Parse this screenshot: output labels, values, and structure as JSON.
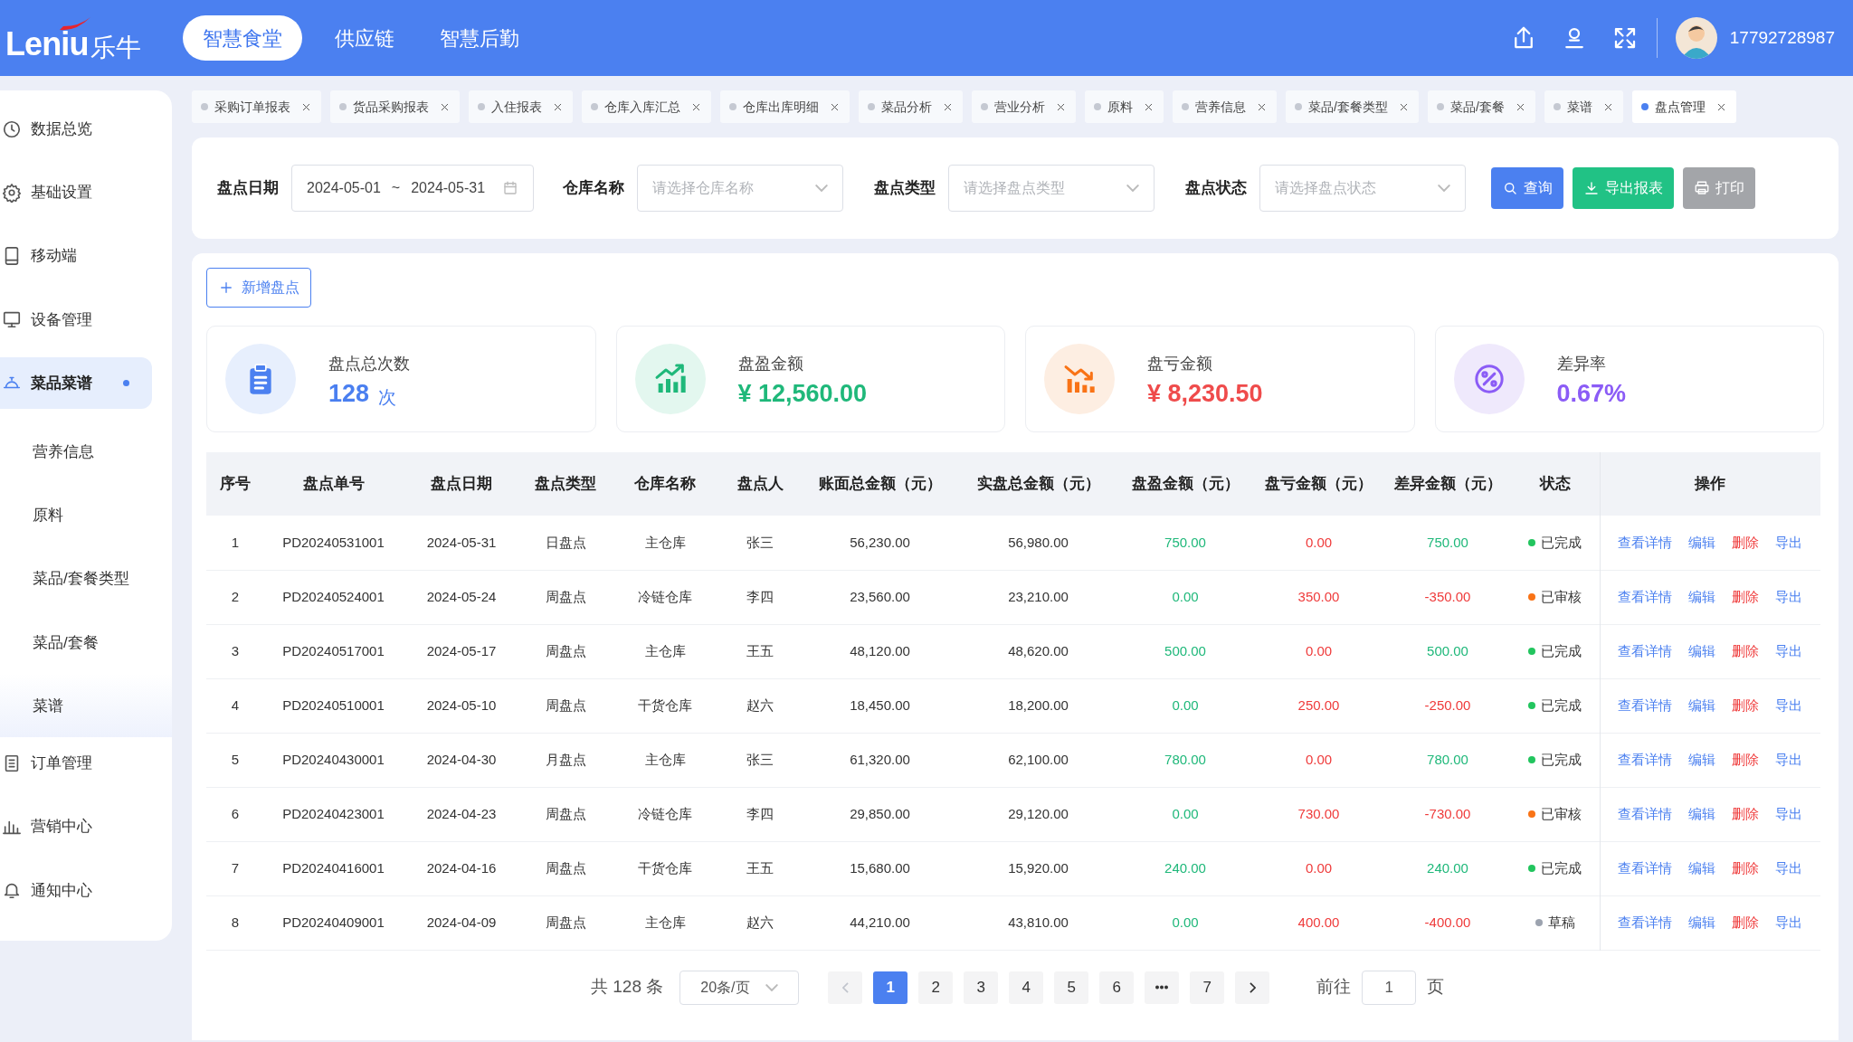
{
  "header": {
    "logo": {
      "latin": "Leniu",
      "chinese": "乐牛"
    },
    "nav": [
      {
        "label": "智慧食堂",
        "selected": true
      },
      {
        "label": "供应链",
        "selected": false
      },
      {
        "label": "智慧后勤",
        "selected": false
      }
    ],
    "user": {
      "phone": "17792728987"
    }
  },
  "tabs": [
    {
      "label": "采购订单报表",
      "selected": false
    },
    {
      "label": "货品采购报表",
      "selected": false
    },
    {
      "label": "入住报表",
      "selected": false
    },
    {
      "label": "仓库入库汇总",
      "selected": false
    },
    {
      "label": "仓库出库明细",
      "selected": false
    },
    {
      "label": "菜品分析",
      "selected": false
    },
    {
      "label": "营业分析",
      "selected": false
    },
    {
      "label": "原料",
      "selected": false
    },
    {
      "label": "营养信息",
      "selected": false
    },
    {
      "label": "菜品/套餐类型",
      "selected": false
    },
    {
      "label": "菜品/套餐",
      "selected": false
    },
    {
      "label": "菜谱",
      "selected": false
    },
    {
      "label": "盘点管理",
      "selected": true
    }
  ],
  "sidebar": {
    "items": [
      {
        "label": "数据总览",
        "selected": false
      },
      {
        "label": "基础设置",
        "selected": false
      },
      {
        "label": "移动端",
        "selected": false
      },
      {
        "label": "设备管理",
        "selected": false
      },
      {
        "label": "菜品菜谱",
        "selected": true,
        "children": [
          {
            "label": "营养信息",
            "selected": false
          },
          {
            "label": "原料",
            "selected": false
          },
          {
            "label": "菜品/套餐类型",
            "selected": false
          },
          {
            "label": "菜品/套餐",
            "selected": false
          },
          {
            "label": "菜谱",
            "selected": true
          }
        ]
      },
      {
        "label": "订单管理",
        "selected": false
      },
      {
        "label": "营销中心",
        "selected": false
      },
      {
        "label": "通知中心",
        "selected": false
      }
    ]
  },
  "filters": [
    {
      "kind": "daterange",
      "label": "盘点日期",
      "start": "2024-05-01",
      "separator": "~",
      "end": "2024-05-31"
    },
    {
      "kind": "select",
      "label": "仓库名称",
      "placeholder": "请选择仓库名称"
    },
    {
      "kind": "select",
      "label": "盘点类型",
      "placeholder": "请选择盘点类型"
    },
    {
      "kind": "select",
      "label": "盘点状态",
      "placeholder": "请选择盘点状态"
    }
  ],
  "filter_buttons": [
    {
      "label": "查询",
      "kind": "search"
    },
    {
      "label": "导出报表",
      "kind": "export"
    },
    {
      "label": "打印",
      "kind": "print"
    }
  ],
  "add_button": {
    "label": "新增盘点"
  },
  "stats": [
    {
      "kind": "clipboard",
      "label": "盘点总次数",
      "value": "128",
      "unit": "次",
      "color": "#4a7ff0"
    },
    {
      "kind": "gain",
      "label": "盘盈金额",
      "value": "¥ 12,560.00",
      "color": "#1fb87a"
    },
    {
      "kind": "loss",
      "label": "盘亏金额",
      "value": "¥ 8,230.50",
      "color": "#ef4b4b"
    },
    {
      "kind": "percent",
      "label": "差异率",
      "value": "0.67%",
      "color": "#8b5cf6"
    }
  ],
  "table": {
    "columns": [
      "序号",
      "盘点单号",
      "盘点日期",
      "盘点类型",
      "仓库名称",
      "盘点人",
      "账面总金额（元）",
      "实盘总金额（元）",
      "盘盈金额（元）",
      "盘亏金额（元）",
      "差异金额（元）",
      "状态",
      "操作"
    ],
    "rows": [
      {
        "kind": "gain",
        "cells": [
          "1",
          "PD20240531001",
          "2024-05-31",
          "日盘点",
          "主仓库",
          "张三",
          "56,230.00",
          "56,980.00",
          "750.00",
          "0.00",
          "750.00"
        ],
        "status": {
          "label": "已完成",
          "color": "#22c55e"
        },
        "actions": [
          "查看详情",
          "编辑",
          "删除",
          "导出"
        ]
      },
      {
        "kind": "loss",
        "cells": [
          "2",
          "PD20240524001",
          "2024-05-24",
          "周盘点",
          "冷链仓库",
          "李四",
          "23,560.00",
          "23,210.00",
          "0.00",
          "350.00",
          "-350.00"
        ],
        "status": {
          "label": "已审核",
          "color": "#f97316"
        },
        "actions": [
          "查看详情",
          "编辑",
          "删除",
          "导出"
        ]
      },
      {
        "kind": "gain",
        "cells": [
          "3",
          "PD20240517001",
          "2024-05-17",
          "周盘点",
          "主仓库",
          "王五",
          "48,120.00",
          "48,620.00",
          "500.00",
          "0.00",
          "500.00"
        ],
        "status": {
          "label": "已完成",
          "color": "#22c55e"
        },
        "actions": [
          "查看详情",
          "编辑",
          "删除",
          "导出"
        ]
      },
      {
        "kind": "loss",
        "cells": [
          "4",
          "PD20240510001",
          "2024-05-10",
          "周盘点",
          "干货仓库",
          "赵六",
          "18,450.00",
          "18,200.00",
          "0.00",
          "250.00",
          "-250.00"
        ],
        "status": {
          "label": "已完成",
          "color": "#22c55e"
        },
        "actions": [
          "查看详情",
          "编辑",
          "删除",
          "导出"
        ]
      },
      {
        "kind": "gain",
        "cells": [
          "5",
          "PD20240430001",
          "2024-04-30",
          "月盘点",
          "主仓库",
          "张三",
          "61,320.00",
          "62,100.00",
          "780.00",
          "0.00",
          "780.00"
        ],
        "status": {
          "label": "已完成",
          "color": "#22c55e"
        },
        "actions": [
          "查看详情",
          "编辑",
          "删除",
          "导出"
        ]
      },
      {
        "kind": "loss",
        "cells": [
          "6",
          "PD20240423001",
          "2024-04-23",
          "周盘点",
          "冷链仓库",
          "李四",
          "29,850.00",
          "29,120.00",
          "0.00",
          "730.00",
          "-730.00"
        ],
        "status": {
          "label": "已审核",
          "color": "#f97316"
        },
        "actions": [
          "查看详情",
          "编辑",
          "删除",
          "导出"
        ]
      },
      {
        "kind": "gain",
        "cells": [
          "7",
          "PD20240416001",
          "2024-04-16",
          "周盘点",
          "干货仓库",
          "王五",
          "15,680.00",
          "15,920.00",
          "240.00",
          "0.00",
          "240.00"
        ],
        "status": {
          "label": "已完成",
          "color": "#22c55e"
        },
        "actions": [
          "查看详情",
          "编辑",
          "删除",
          "导出"
        ]
      },
      {
        "kind": "loss",
        "cells": [
          "8",
          "PD20240409001",
          "2024-04-09",
          "周盘点",
          "主仓库",
          "赵六",
          "44,210.00",
          "43,810.00",
          "0.00",
          "400.00",
          "-400.00"
        ],
        "status": {
          "label": "草稿",
          "color": "#9ca3af"
        },
        "actions": [
          "查看详情",
          "编辑",
          "删除",
          "导出"
        ]
      }
    ]
  },
  "pagination": {
    "total": "共 128 条",
    "page_size": "20条/页",
    "pages": [
      {
        "kind": "page",
        "label": "1",
        "selected": true
      },
      {
        "kind": "page",
        "label": "2",
        "selected": false
      },
      {
        "kind": "page",
        "label": "3",
        "selected": false
      },
      {
        "kind": "page",
        "label": "4",
        "selected": false
      },
      {
        "kind": "page",
        "label": "5",
        "selected": false
      },
      {
        "kind": "page",
        "label": "6",
        "selected": false
      },
      {
        "kind": "ellipsis"
      },
      {
        "kind": "page",
        "label": "7",
        "selected": false
      }
    ],
    "goto_label": "前往",
    "goto_value": "1",
    "goto_suffix": "页"
  }
}
